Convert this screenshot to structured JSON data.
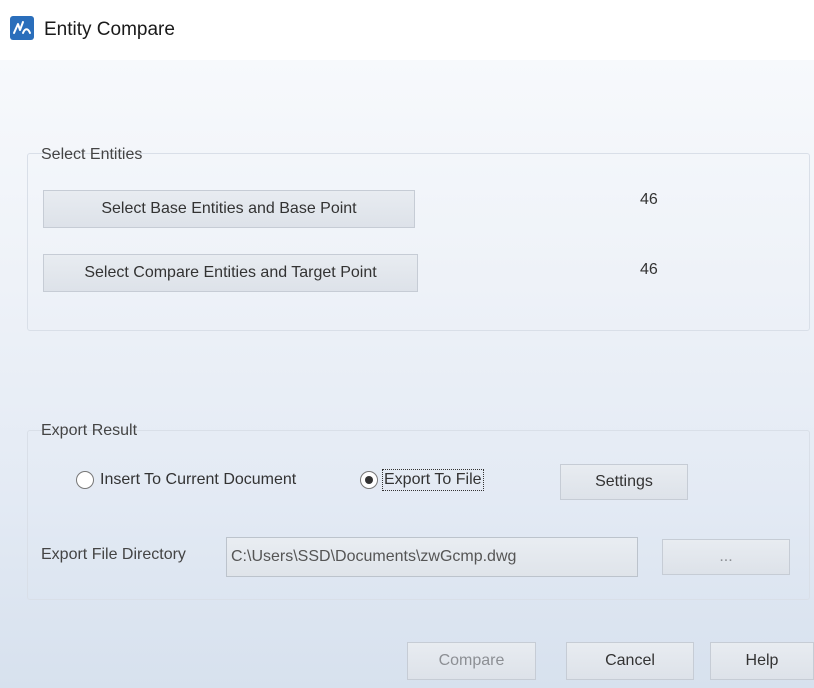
{
  "window": {
    "title": "Entity Compare",
    "icon": "app-logo-icon"
  },
  "select_entities": {
    "group_label": "Select Entities",
    "base_button_label": "Select Base Entities and Base Point",
    "base_count": "46",
    "compare_button_label": "Select Compare Entities and Target Point",
    "compare_count": "46"
  },
  "export_result": {
    "group_label": "Export Result",
    "option_insert_label": "Insert To Current Document",
    "option_insert_checked": false,
    "option_file_label": "Export To File",
    "option_file_checked": true,
    "settings_button_label": "Settings",
    "directory_label": "Export File Directory",
    "directory_value": "C:\\Users\\SSD\\Documents\\zwGcmp.dwg",
    "browse_button_label": "..."
  },
  "footer": {
    "compare_label": "Compare",
    "cancel_label": "Cancel",
    "help_label": "Help"
  },
  "colors": {
    "accent": "#2a6ebb",
    "background_top": "#f7f9fc",
    "background_bottom": "#d7e1ee"
  }
}
